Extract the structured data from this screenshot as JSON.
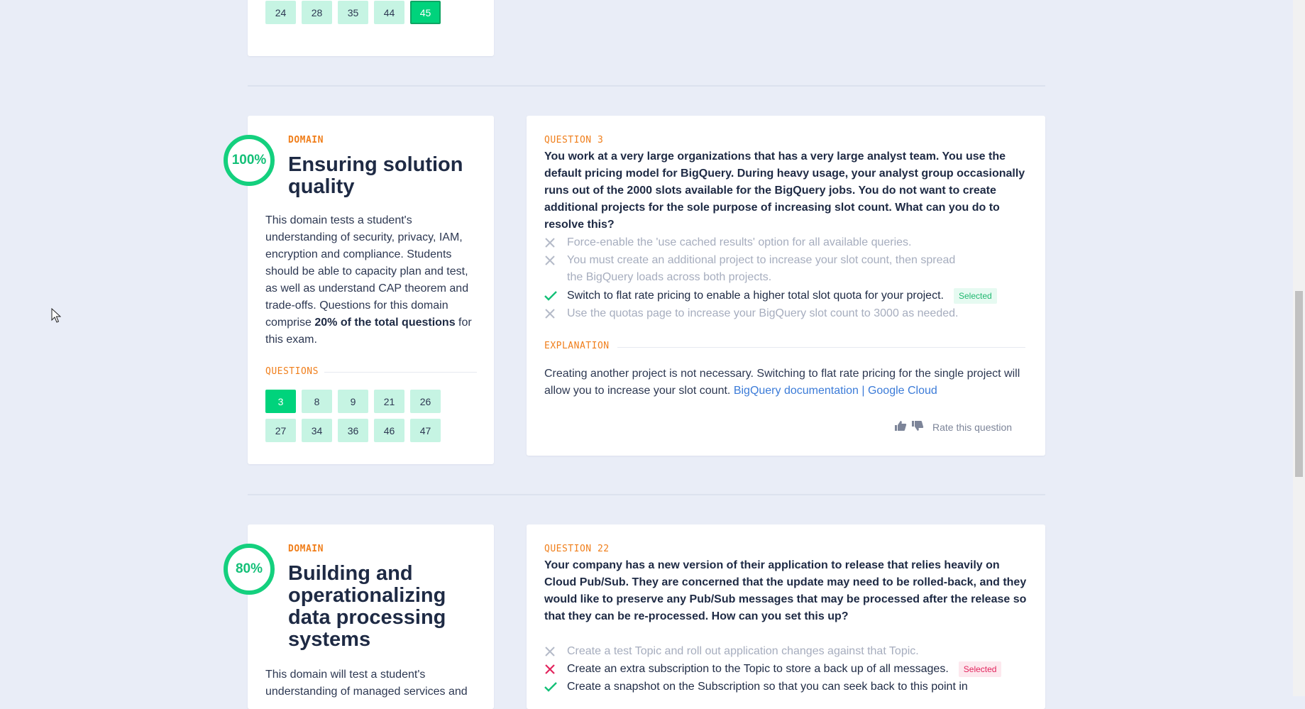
{
  "top_grid": {
    "buttons": [
      "24",
      "28",
      "35",
      "44",
      "45"
    ],
    "active": "45"
  },
  "domain_quality": {
    "percent": "100%",
    "progress": 1.0,
    "kicker": "DOMAIN",
    "title": "Ensuring solution quality",
    "description_pre": "This domain tests a student's understanding of security, privacy, IAM, encryption and compliance. Students should be able to capacity plan and test, as well as understand CAP theorem and trade-offs. Questions for this domain comprise ",
    "description_bold": "20% of the total questions",
    "description_post": " for this exam.",
    "questions_label": "QUESTIONS",
    "questions": [
      "3",
      "8",
      "9",
      "21",
      "26",
      "27",
      "34",
      "36",
      "46",
      "47"
    ],
    "active_question": "3"
  },
  "question_3": {
    "label": "QUESTION 3",
    "text": "You work at a very large organizations that has a very large analyst team. You use the default pricing model for BigQuery. During heavy usage, your analyst group occasionally runs out of the 2000 slots available for the BigQuery jobs. You do not want to create additional projects for the sole purpose of increasing slot count. What can you do to resolve this?",
    "answers": [
      {
        "text": "Force-enable the 'use cached results' option for all available queries.",
        "mark": "x-icon",
        "state": "dim"
      },
      {
        "text": "You must create an additional project to increase your slot count, then spread the BigQuery loads across both projects.",
        "mark": "x-icon",
        "state": "dim"
      },
      {
        "text": "Switch to flat rate pricing to enable a higher total slot quota for your project.",
        "mark": "check-icon",
        "state": "on",
        "badge": "Selected"
      },
      {
        "text": "Use the quotas page to increase your BigQuery slot count to 3000 as needed.",
        "mark": "x-icon",
        "state": "dim"
      }
    ],
    "explanation_label": "EXPLANATION",
    "explanation": "Creating another project is not necessary. Switching to flat rate pricing for the single project will allow you to increase your slot count. ",
    "link_text": "BigQuery documentation | Google Cloud",
    "rate_label": "Rate this question"
  },
  "domain_building": {
    "percent": "80%",
    "progress": 0.8,
    "kicker": "DOMAIN",
    "title": "Building and operationalizing data processing systems",
    "description": "This domain will test a student's understanding of managed services and"
  },
  "question_22": {
    "label": "QUESTION 22",
    "text": "Your company has a new version of their application to release that relies heavily on Cloud Pub/Sub. They are concerned that the update may need to be rolled-back, and they would like to preserve any Pub/Sub messages that may be processed after the release so that they can be re-processed. How can you set this up?",
    "answers": [
      {
        "text": "Create a test Topic and roll out application changes against that Topic.",
        "mark": "x-icon",
        "state": "dim"
      },
      {
        "text": "Create an extra subscription to the Topic to store a back up of all messages.",
        "mark": "x-red-icon",
        "state": "on",
        "badge": "Selected"
      },
      {
        "text": "Create a snapshot on the Subscription so that you can seek back to this point in",
        "mark": "check-icon",
        "state": "on"
      }
    ]
  },
  "colors": {
    "background": "#e9edf7",
    "accent_green": "#00d37c",
    "kicker_orange": "#f07f1c",
    "link_blue": "#3b7bd8",
    "error_red": "#e2245d"
  }
}
